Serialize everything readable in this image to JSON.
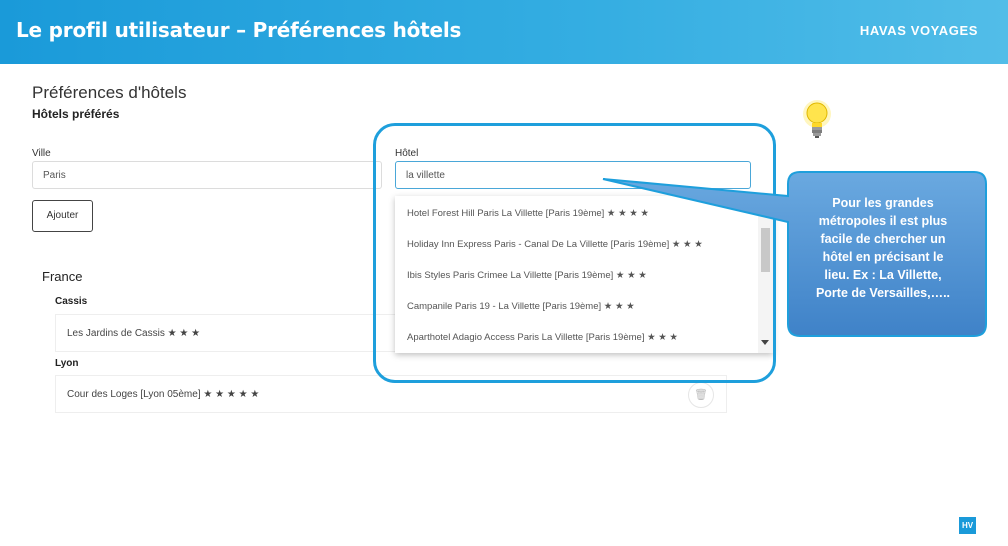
{
  "banner": {
    "title": "Le profil utilisateur – Préférences hôtels",
    "brand": "HAVAS VOYAGES"
  },
  "section": {
    "title": "Préférences d'hôtels",
    "subtitle": "Hôtels préférés"
  },
  "form": {
    "ville_label": "Ville",
    "ville_value": "Paris",
    "hotel_label": "Hôtel",
    "hotel_value": "la villette",
    "add_button": "Ajouter"
  },
  "dropdown": [
    "Hotel Forest Hill Paris La Villette [Paris 19ème] ★ ★ ★ ★",
    "Holiday Inn Express Paris - Canal De La Villette [Paris 19ème] ★ ★ ★",
    "Ibis Styles Paris Crimee La Villette [Paris 19ème] ★ ★ ★",
    "Campanile Paris 19 - La Villette [Paris 19ème] ★ ★ ★",
    "Aparthotel Adagio Access Paris La Villette [Paris 19ème] ★ ★ ★"
  ],
  "favorites": {
    "country": "France",
    "cities": [
      {
        "name": "Cassis",
        "hotel": "Les Jardins de Cassis ★ ★ ★"
      },
      {
        "name": "Lyon",
        "hotel": "Cour des Loges [Lyon 05ème] ★ ★ ★ ★ ★"
      }
    ]
  },
  "callout": {
    "line1": "Pour les grandes",
    "line2": "métropoles il est plus",
    "line3": "facile de chercher un",
    "line4": "hôtel en précisant le",
    "line5": "lieu. Ex : La Villette,",
    "line6": "Porte de Versailles,…..",
    "fill": "#4a8fd0",
    "border": "#1e9fdc"
  },
  "footer": {
    "logo": "HV"
  },
  "colors": {
    "accent": "#1a9ad9"
  }
}
